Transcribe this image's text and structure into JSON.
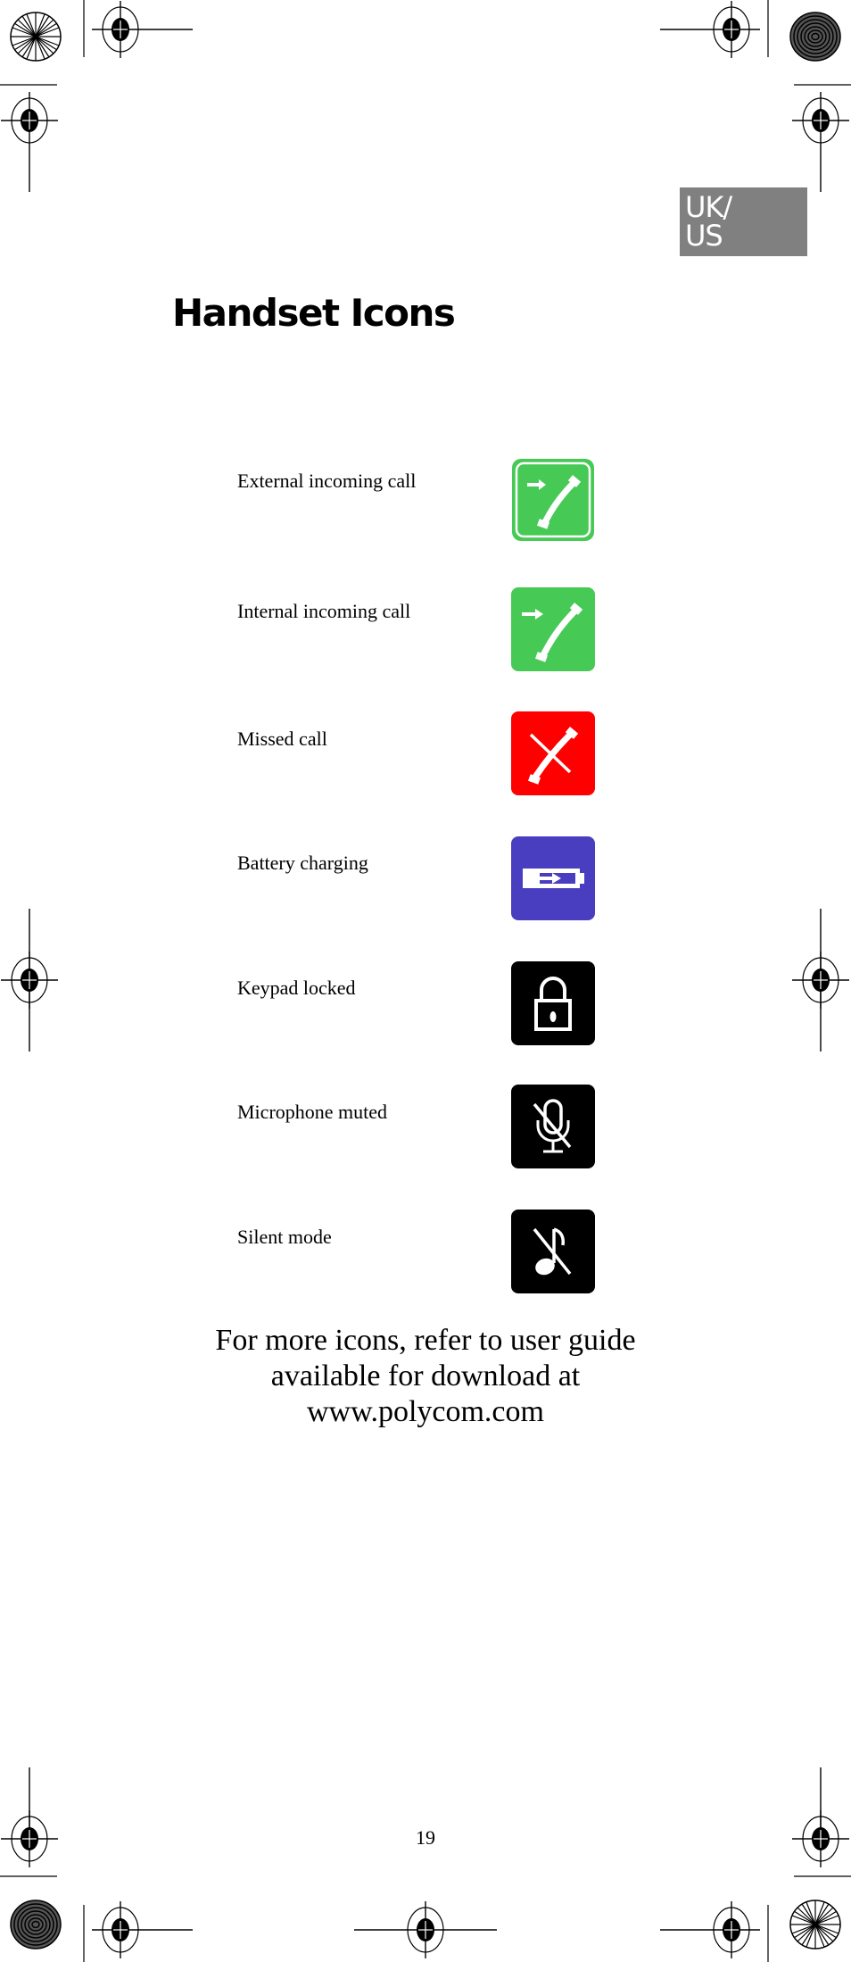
{
  "language_badge": {
    "line1": "UK/",
    "line2": "US"
  },
  "page_title": "Handset Icons",
  "icons": [
    {
      "label": "External incoming call",
      "icon": "external-incoming-call-icon",
      "color": "#46c955"
    },
    {
      "label": "Internal incoming call",
      "icon": "internal-incoming-call-icon",
      "color": "#46c955"
    },
    {
      "label": "Missed call",
      "icon": "missed-call-icon",
      "color": "#ff0000"
    },
    {
      "label": "Battery charging",
      "icon": "battery-charging-icon",
      "color": "#4a3ec0"
    },
    {
      "label": "Keypad locked",
      "icon": "keypad-locked-icon",
      "color": "#000000"
    },
    {
      "label": "Microphone muted",
      "icon": "microphone-muted-icon",
      "color": "#000000"
    },
    {
      "label": "Silent mode",
      "icon": "silent-mode-icon",
      "color": "#000000"
    }
  ],
  "footer_note": {
    "line1": "For more icons, refer to user guide",
    "line2": "available for download at",
    "line3": "www.polycom.com"
  },
  "page_number": "19"
}
